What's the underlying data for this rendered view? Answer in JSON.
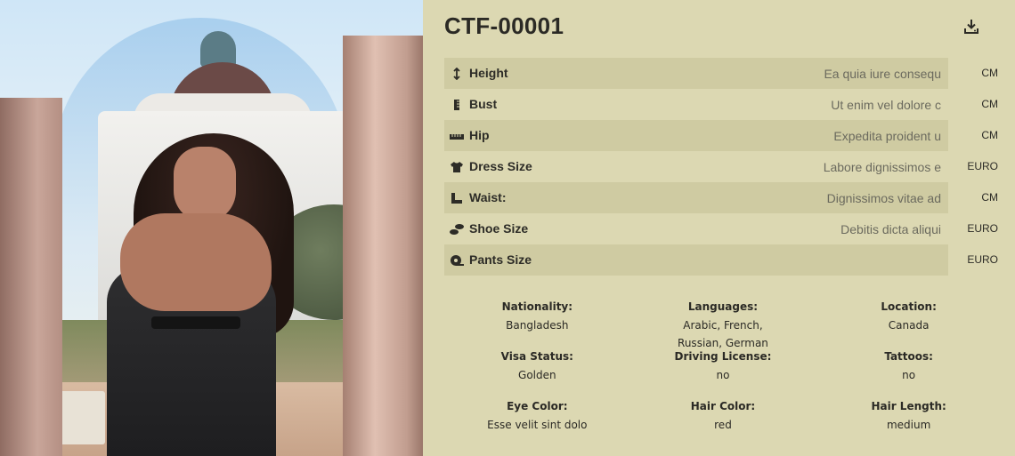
{
  "profile": {
    "code": "CTF-00001",
    "download_icon": "download-icon"
  },
  "measurements": [
    {
      "icon": "height-arrows-icon",
      "label": "Height",
      "value": "Ea quia iure consequ",
      "unit": "CM"
    },
    {
      "icon": "ruler-vertical-icon",
      "label": "Bust",
      "value": "Ut enim vel dolore c",
      "unit": "CM"
    },
    {
      "icon": "ruler-horizontal-icon",
      "label": "Hip",
      "value": "Expedita proident u",
      "unit": "CM"
    },
    {
      "icon": "tshirt-icon",
      "label": "Dress Size",
      "value": "Labore dignissimos e",
      "unit": "EURO"
    },
    {
      "icon": "ruler-combined-icon",
      "label": "Waist:",
      "value": "Dignissimos vitae ad",
      "unit": "CM"
    },
    {
      "icon": "shoe-prints-icon",
      "label": "Shoe Size",
      "value": "Debitis dicta aliqui",
      "unit": "EURO"
    },
    {
      "icon": "tape-icon",
      "label": "Pants Size",
      "value": "",
      "unit": "EURO"
    }
  ],
  "details": [
    {
      "label": "Nationality:",
      "value": "Bangladesh"
    },
    {
      "label": "Languages:",
      "value": "Arabic, French, Russian, German"
    },
    {
      "label": "Location:",
      "value": "Canada"
    },
    {
      "label": "Visa Status:",
      "value": "Golden"
    },
    {
      "label": "Driving License:",
      "value": "no"
    },
    {
      "label": "Tattoos:",
      "value": "no"
    },
    {
      "label": "Eye Color:",
      "value": "Esse velit sint dolo"
    },
    {
      "label": "Hair Color:",
      "value": "red"
    },
    {
      "label": "Hair Length:",
      "value": "medium"
    }
  ]
}
